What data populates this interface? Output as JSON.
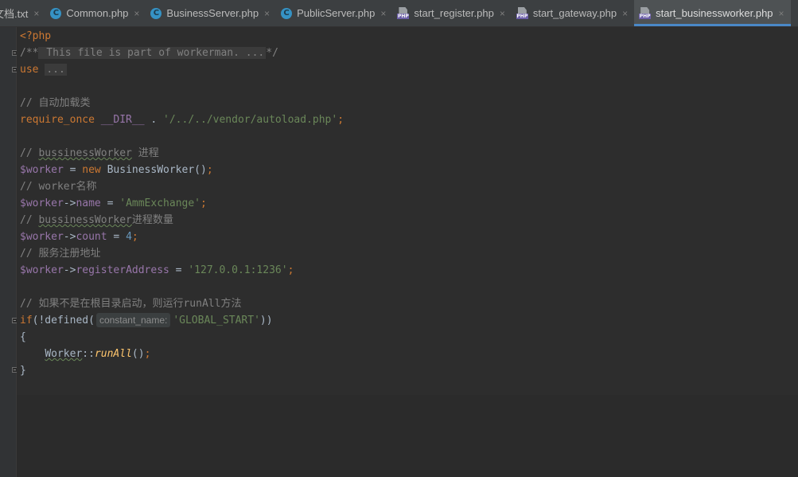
{
  "tabs": [
    {
      "label": "文档.txt",
      "icon": "text-file-icon",
      "active": false
    },
    {
      "label": "Common.php",
      "icon": "php-class-icon",
      "active": false
    },
    {
      "label": "BusinessServer.php",
      "icon": "php-class-icon",
      "active": false
    },
    {
      "label": "PublicServer.php",
      "icon": "php-class-icon",
      "active": false
    },
    {
      "label": "start_register.php",
      "icon": "php-file-icon",
      "active": false
    },
    {
      "label": "start_gateway.php",
      "icon": "php-file-icon",
      "active": false
    },
    {
      "label": "start_businessworker.php",
      "icon": "php-file-icon",
      "active": true
    }
  ],
  "tab_close_glyph": "×",
  "code": {
    "l1": "<?php",
    "l2_open": "/**",
    "l2_body": " This file is part of workerman. ...",
    "l2_close": "*/",
    "l3_kw": "use",
    "l3_fold": "...",
    "c1": "// 自动加载类",
    "req_kw": "require_once",
    "req_const": "__DIR__",
    "req_dot": " . ",
    "req_str": "'/../../vendor/autoload.php'",
    "semi": ";",
    "c2_pre": "// ",
    "c2_word": "bussinessWorker",
    "c2_post": " 进程",
    "var_worker": "$worker",
    "assign": " = ",
    "new_kw": "new",
    "class_bw": " BusinessWorker()",
    "c3": "// worker名称",
    "arrow": "->",
    "prop_name": "name",
    "val_name": "'AmmExchange'",
    "c4_pre": "// ",
    "c4_word": "bussinessWorker",
    "c4_post": "进程数量",
    "prop_count": "count",
    "val_count": "4",
    "c5": "// 服务注册地址",
    "prop_reg": "registerAddress",
    "val_reg": "'127.0.0.1:1236'",
    "c6": "// 如果不是在根目录启动，则运行runAll方法",
    "if_kw": "if",
    "if_call": "(!defined(",
    "hint": "constant_name:",
    "if_str": "'GLOBAL_START'",
    "if_close": "))",
    "brace_open": "{",
    "indent": "    ",
    "worker_class": "Worker",
    "scope": "::",
    "run_fn": "runAll",
    "call_end": "()",
    "brace_close": "}"
  }
}
